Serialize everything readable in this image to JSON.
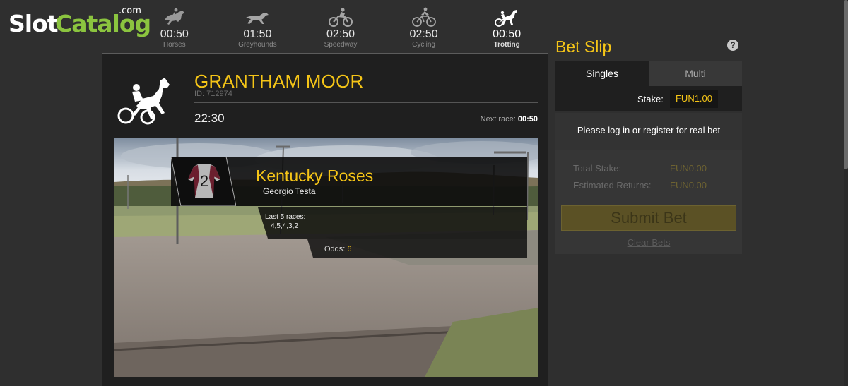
{
  "logo": {
    "slot": "Slot",
    "catalog": "Catalog",
    "com": ".com"
  },
  "sports": [
    {
      "time": "00:50",
      "name": "Horses",
      "icon": "horse-rider-icon"
    },
    {
      "time": "01:50",
      "name": "Greyhounds",
      "icon": "greyhound-icon"
    },
    {
      "time": "02:50",
      "name": "Speedway",
      "icon": "motorbike-icon"
    },
    {
      "time": "02:50",
      "name": "Cycling",
      "icon": "cyclist-icon"
    },
    {
      "time": "00:50",
      "name": "Trotting",
      "icon": "trotting-sulky-icon",
      "active": true
    }
  ],
  "race": {
    "name": "GRANTHAM MOOR",
    "id": "ID: 712974",
    "time": "22:30",
    "next_race_label": "Next race:",
    "next_race_time": "00:50"
  },
  "runner": {
    "number": "2",
    "name": "Kentucky Roses",
    "jockey": "Georgio Testa",
    "last5_label": "Last 5 races:",
    "last5_value": "4,5,4,3,2",
    "odds_label": "Odds:",
    "odds_value": "6"
  },
  "betslip": {
    "title": "Bet Slip",
    "help": "?",
    "tabs": [
      "Singles",
      "Multi"
    ],
    "active_tab": "Singles",
    "stake_label": "Stake:",
    "stake_value": "FUN1.00",
    "login_message": "Please log in or register for real bet",
    "total_stake_label": "Total Stake:",
    "total_stake_value": "FUN0.00",
    "est_returns_label": "Estimated Returns:",
    "est_returns_value": "FUN0.00",
    "submit_label": "Submit Bet",
    "clear_label": "Clear Bets"
  },
  "colors": {
    "accent": "#f5c517",
    "background": "#2f2f2f",
    "panel": "#1f1f1f",
    "logo_green": "#8bc43f"
  }
}
